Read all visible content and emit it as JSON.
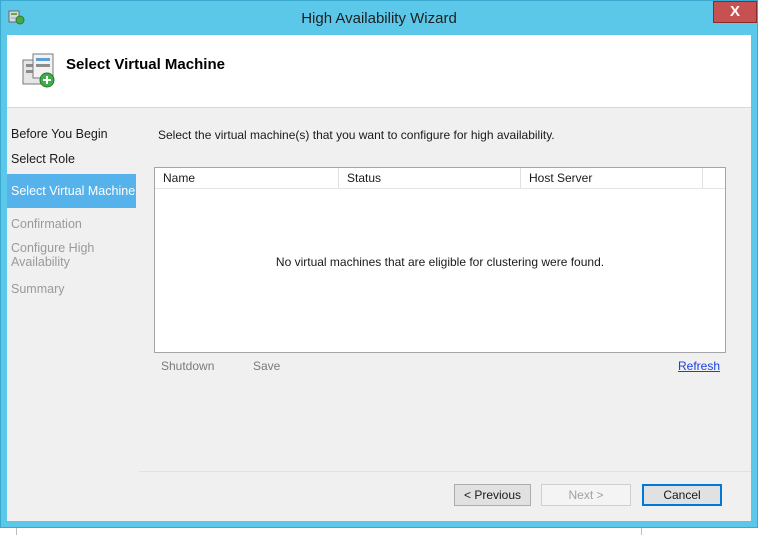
{
  "window": {
    "title": "High Availability Wizard",
    "close_label": "X",
    "accent_color": "#5bc8ea"
  },
  "header": {
    "title": "Select Virtual Machine",
    "icon": "server-wizard-icon"
  },
  "nav": {
    "items": [
      {
        "label": "Before You Begin",
        "state": "normal"
      },
      {
        "label": "Select Role",
        "state": "normal"
      },
      {
        "label": "Select Virtual Machine",
        "state": "selected"
      },
      {
        "label": "Confirmation",
        "state": "disabled"
      },
      {
        "label": "Configure High Availability",
        "state": "disabled"
      },
      {
        "label": "Summary",
        "state": "disabled"
      }
    ],
    "selected_color": "#56b2eb"
  },
  "content": {
    "instruction": "Select the virtual machine(s) that you want to configure for high availability.",
    "table": {
      "columns": [
        "Name",
        "Status",
        "Host Server"
      ],
      "rows": [],
      "empty_message": "No virtual machines that are eligible for clustering were found."
    },
    "actions": {
      "shutdown": "Shutdown",
      "save": "Save",
      "refresh": "Refresh"
    }
  },
  "footer": {
    "previous": "< Previous",
    "next": "Next >",
    "cancel": "Cancel"
  }
}
